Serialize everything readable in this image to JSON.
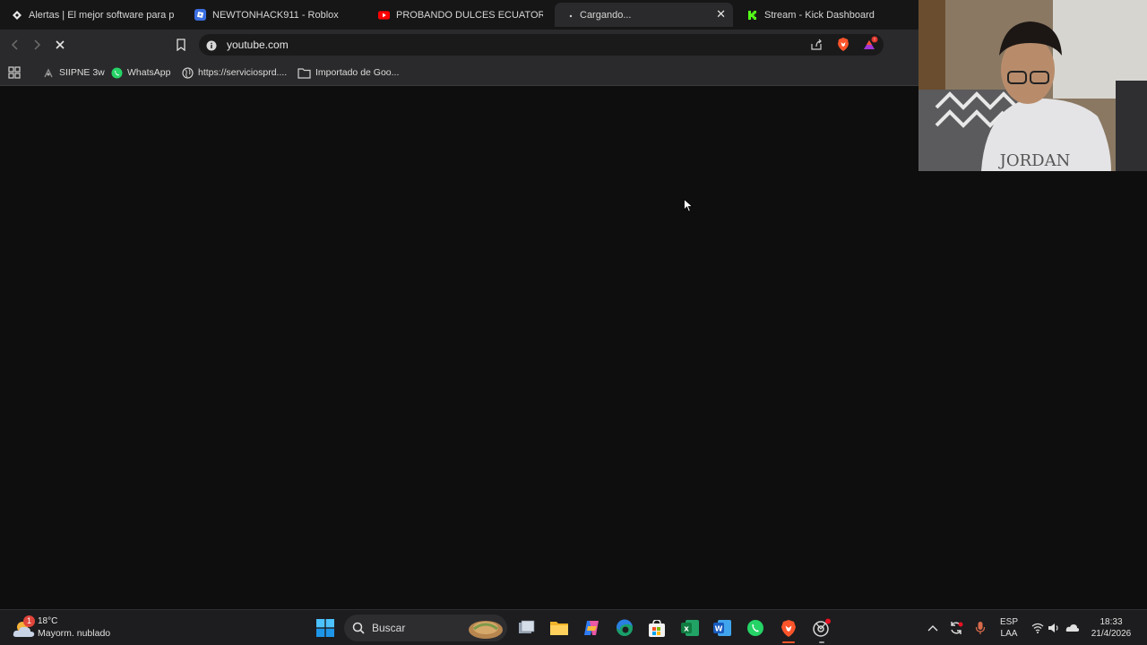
{
  "tabs": [
    {
      "label": "Alertas | El mejor software para pote",
      "icon": "streamlabs-icon",
      "active": false
    },
    {
      "label": "NEWTONHACK911 - Roblox",
      "icon": "roblox-icon",
      "active": false
    },
    {
      "label": "PROBANDO DULCES ECUATORIANOS",
      "icon": "youtube-icon",
      "active": false
    },
    {
      "label": "Cargando...",
      "icon": "loading-icon",
      "active": true
    },
    {
      "label": "Stream - Kick Dashboard",
      "icon": "kick-icon",
      "active": false
    }
  ],
  "toolbar": {
    "url": "youtube.com"
  },
  "bookmarks": [
    {
      "label": "SIIPNE 3w",
      "icon": "siipne-icon"
    },
    {
      "label": "WhatsApp",
      "icon": "whatsapp-icon"
    },
    {
      "label": "https://serviciosprd....",
      "icon": "globe-icon"
    },
    {
      "label": "Importado de Goo...",
      "icon": "folder-icon"
    }
  ],
  "weather": {
    "temperature": "18°C",
    "condition": "Mayorm. nublado",
    "badge": "1"
  },
  "taskbar": {
    "search_label": "Buscar"
  },
  "tray": {
    "language_top": "ESP",
    "language_bottom": "LAA",
    "time": "18:33",
    "date": "21/4/2026"
  },
  "colors": {
    "page_bg": "#0f0e0f",
    "toolbar_bg": "#2a2a2c",
    "brave_orange": "#fb542b",
    "kick_green": "#53fc18",
    "youtube_red": "#ff0000",
    "whatsapp_green": "#25d366"
  }
}
